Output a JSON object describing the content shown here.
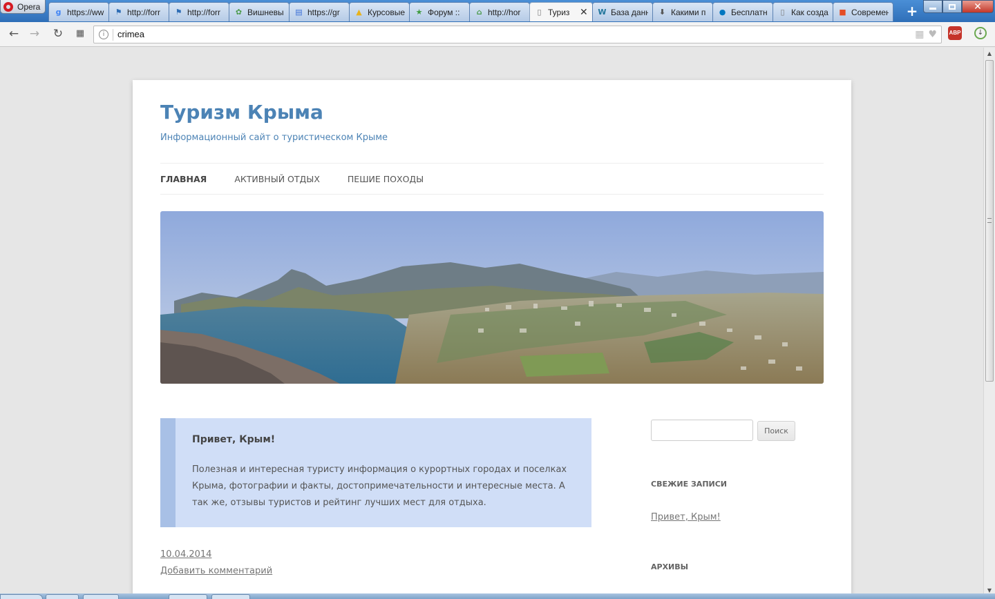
{
  "browser": {
    "app_name": "Opera",
    "tabs": [
      {
        "icon": "google-icon",
        "title": "https://ww",
        "icon_color": "#4285f4"
      },
      {
        "icon": "flag-icon",
        "title": "http://forr",
        "icon_color": "#2e6db5"
      },
      {
        "icon": "flag-icon",
        "title": "http://forr",
        "icon_color": "#2e6db5"
      },
      {
        "icon": "cherry-icon",
        "title": "Вишневы",
        "icon_color": "#4a9a4a"
      },
      {
        "icon": "docs-icon",
        "title": "https://gr",
        "icon_color": "#3b6fd6"
      },
      {
        "icon": "drive-icon",
        "title": "Курсовые",
        "icon_color": "#e8b21b"
      },
      {
        "icon": "star-icon",
        "title": "Форум ::",
        "icon_color": "#3f9b3f"
      },
      {
        "icon": "home-icon",
        "title": "http://hor",
        "icon_color": "#4a9a4a"
      },
      {
        "icon": "page-icon",
        "title": "Туриз",
        "icon_color": "#777777",
        "active": true
      },
      {
        "icon": "wordpress-icon",
        "title": "База данн",
        "icon_color": "#21759b"
      },
      {
        "icon": "download-icon",
        "title": "Какими п",
        "icon_color": "#555555"
      },
      {
        "icon": "drupal-icon",
        "title": "Бесплатн",
        "icon_color": "#0077c0"
      },
      {
        "icon": "page-icon",
        "title": "Как созда",
        "icon_color": "#777777"
      },
      {
        "icon": "windows-icon",
        "title": "Современ",
        "icon_color": "#e44d26"
      }
    ],
    "address": "crimea",
    "abp_label": "ABP"
  },
  "site": {
    "title": "Туризм Крыма",
    "description": "Информационный сайт о туристическом Крыме",
    "nav": [
      {
        "label": "Главная",
        "current": true
      },
      {
        "label": "Активный отдых",
        "current": false
      },
      {
        "label": "Пешие походы",
        "current": false
      }
    ],
    "header_image": "crimea-panorama-image"
  },
  "post": {
    "title": "Привет, Крым!",
    "body": "Полезная и интересная туристу информация о курортных городах и поселках Крыма, фотографии и факты, достопримечательности и интересные места. А так же, отзывы туристов и рейтинг лучших мест для отдыха.",
    "date": "10.04.2014",
    "comment_link": "Добавить комментарий"
  },
  "sidebar": {
    "search_button": "Поиск",
    "search_placeholder": "",
    "recent_title": "Свежие записи",
    "recent_items": [
      "Привет, Крым!"
    ],
    "archives_title": "Архивы"
  },
  "colors": {
    "site_accent": "#4c83b5",
    "post_background": "#d0def7",
    "post_bar": "#a8c0e6"
  }
}
